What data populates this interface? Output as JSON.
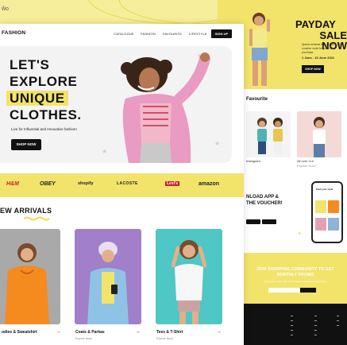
{
  "background": {
    "crumb": "ŵo"
  },
  "main": {
    "logo": "FASHION",
    "nav": [
      "CATALOGUE",
      "FASHION",
      "FAVOURITE",
      "LIFESTYLE"
    ],
    "signup": "SIGN UP",
    "hero": {
      "lines": [
        "LET'S",
        "EXPLORE",
        "UNIQUE",
        "CLOTHES."
      ],
      "subtitle": "Live for Influential and Innovative fashion!",
      "cta": "SHOP NOW"
    },
    "brands": [
      "H&M",
      "OBEY",
      "shopify",
      "LACOSTE",
      "Levi's",
      "amazon"
    ],
    "section_title": "EW ARRIVALS",
    "products": [
      {
        "name": "odies & Sweatshirt",
        "sub": ""
      },
      {
        "name": "Coats & Parkas",
        "sub": "Explore Now!"
      },
      {
        "name": "Tees & T-Shirt",
        "sub": "Explore Now!"
      }
    ]
  },
  "side": {
    "hero_title_1": "PAYDAY",
    "hero_title_2": "SALE NOW",
    "hero_desc": "Spend minimal $99 get 30% off voucher code for your next purchase",
    "hero_date": "1 June - 10 June 2021",
    "hero_btn": "SHOP NOW",
    "section": "Favourite",
    "card1_label": "Instagram",
    "card2_label": "All over Cut",
    "card2_sub": "Explore Now!",
    "app_title_1": "NLOAD APP &",
    "app_title_2": "THE VOUCHER!",
    "join_title": "JOIN SHOPPING COMMUNITY TO GET MONTHLY PROMO",
    "join_sub": "Type your email down below and be young wild generation",
    "phone_title": "Find your style"
  },
  "colors": {
    "accent": "#f2e36b",
    "dark": "#111111",
    "orange": "#f58a1f",
    "purple": "#a17fc9",
    "teal": "#4fc7c4"
  }
}
